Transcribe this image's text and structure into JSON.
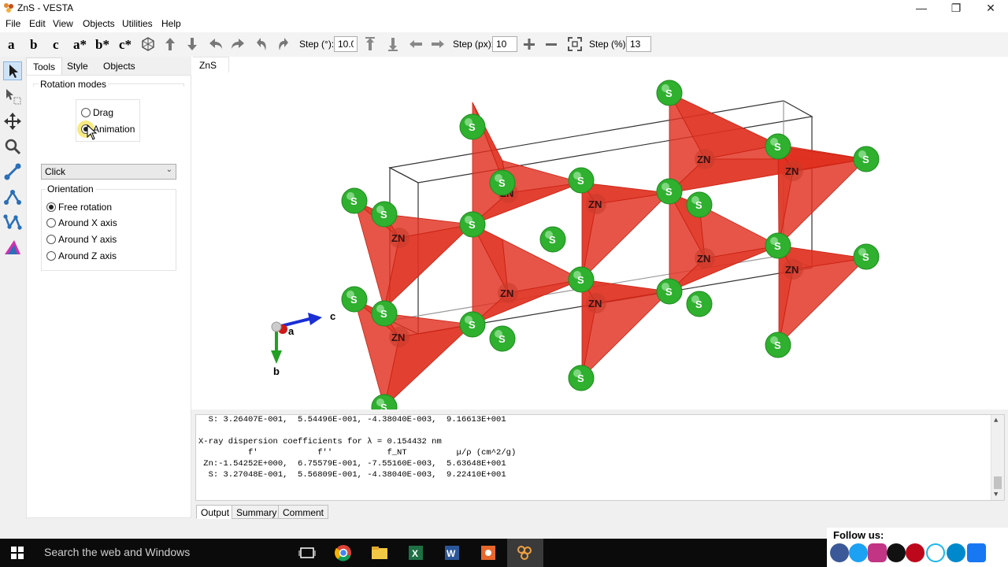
{
  "window": {
    "title": "ZnS - VESTA",
    "minimize_glyph": "—",
    "restore_glyph": "❐",
    "close_glyph": "✕"
  },
  "menu": [
    "File",
    "Edit",
    "View",
    "Objects",
    "Utilities",
    "Help"
  ],
  "toolbar": {
    "axis_buttons": [
      "a",
      "b",
      "c",
      "a*",
      "b*",
      "c*"
    ],
    "step_deg_label": "Step (°):",
    "step_deg_value": "10.0",
    "step_px_label": "Step (px):",
    "step_px_value": "10",
    "step_pct_label": "Step (%):",
    "step_pct_value": "13"
  },
  "panel": {
    "tabs": [
      "Tools",
      "Style",
      "Objects"
    ],
    "rotation_modes_label": "Rotation modes",
    "modes": [
      {
        "label": "Drag",
        "checked": false
      },
      {
        "label": "Animation",
        "checked": true
      }
    ],
    "click_select_value": "Click",
    "orientation_label": "Orientation",
    "orientation_options": [
      {
        "label": "Free rotation",
        "checked": true
      },
      {
        "label": "Around X axis",
        "checked": false
      },
      {
        "label": "Around Y axis",
        "checked": false
      },
      {
        "label": "Around Z axis",
        "checked": false
      }
    ]
  },
  "viewer": {
    "tab_label": "ZnS",
    "axis_labels": {
      "a": "a",
      "b": "b",
      "c": "c"
    },
    "sulfur_label": "S",
    "zinc_label": "ZN"
  },
  "output": {
    "lines": [
      "  S: 3.26407E-001,  5.54496E-001, -4.38040E-003,  9.16613E+001",
      "",
      "X-ray dispersion coefficients for λ = 0.154432 nm",
      "          f'            f''           f_NT          μ/ρ (cm^2/g)",
      " Zn:-1.54252E+000,  6.75579E-001, -7.55160E-003,  5.63648E+001",
      "  S: 3.27048E-001,  5.56809E-001, -4.38040E-003,  9.22410E+001"
    ],
    "tabs": [
      "Output",
      "Summary",
      "Comment"
    ]
  },
  "taskbar": {
    "search_placeholder": "Search the web and Windows"
  },
  "follow": {
    "title": "Follow us:"
  },
  "colors": {
    "tetrahedron": "#e03020",
    "sulfur": "#2fb02f",
    "axis_b": "#22a022",
    "axis_c": "#1a2fd6",
    "axis_a": "#d01818"
  }
}
